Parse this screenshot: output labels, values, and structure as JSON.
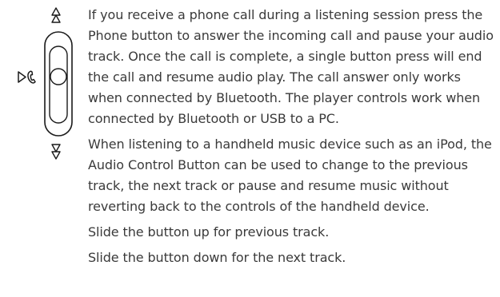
{
  "document": {
    "paragraphs": [
      "If you receive a phone call during a listening session press the Phone button to answer the incoming call and pause your audio track. Once the call is complete, a single button press will end the call and resume audio play. The call answer only works when connected by Bluetooth.  The player controls work when connected by Bluetooth or USB to a PC.",
      "When listening to a handheld music device such as an iPod, the Audio Control Button can be used to change to the previous track, the next track or pause and resume music without reverting back to the controls of the handheld device.",
      "Slide the button up for previous track.",
      "Slide the button down for the next track."
    ]
  },
  "diagram": {
    "icons": [
      "previous-track-icon",
      "phone-icon",
      "next-track-icon"
    ],
    "stroke_color": "#1a1a1a",
    "text_color": "#3a3a3a"
  }
}
